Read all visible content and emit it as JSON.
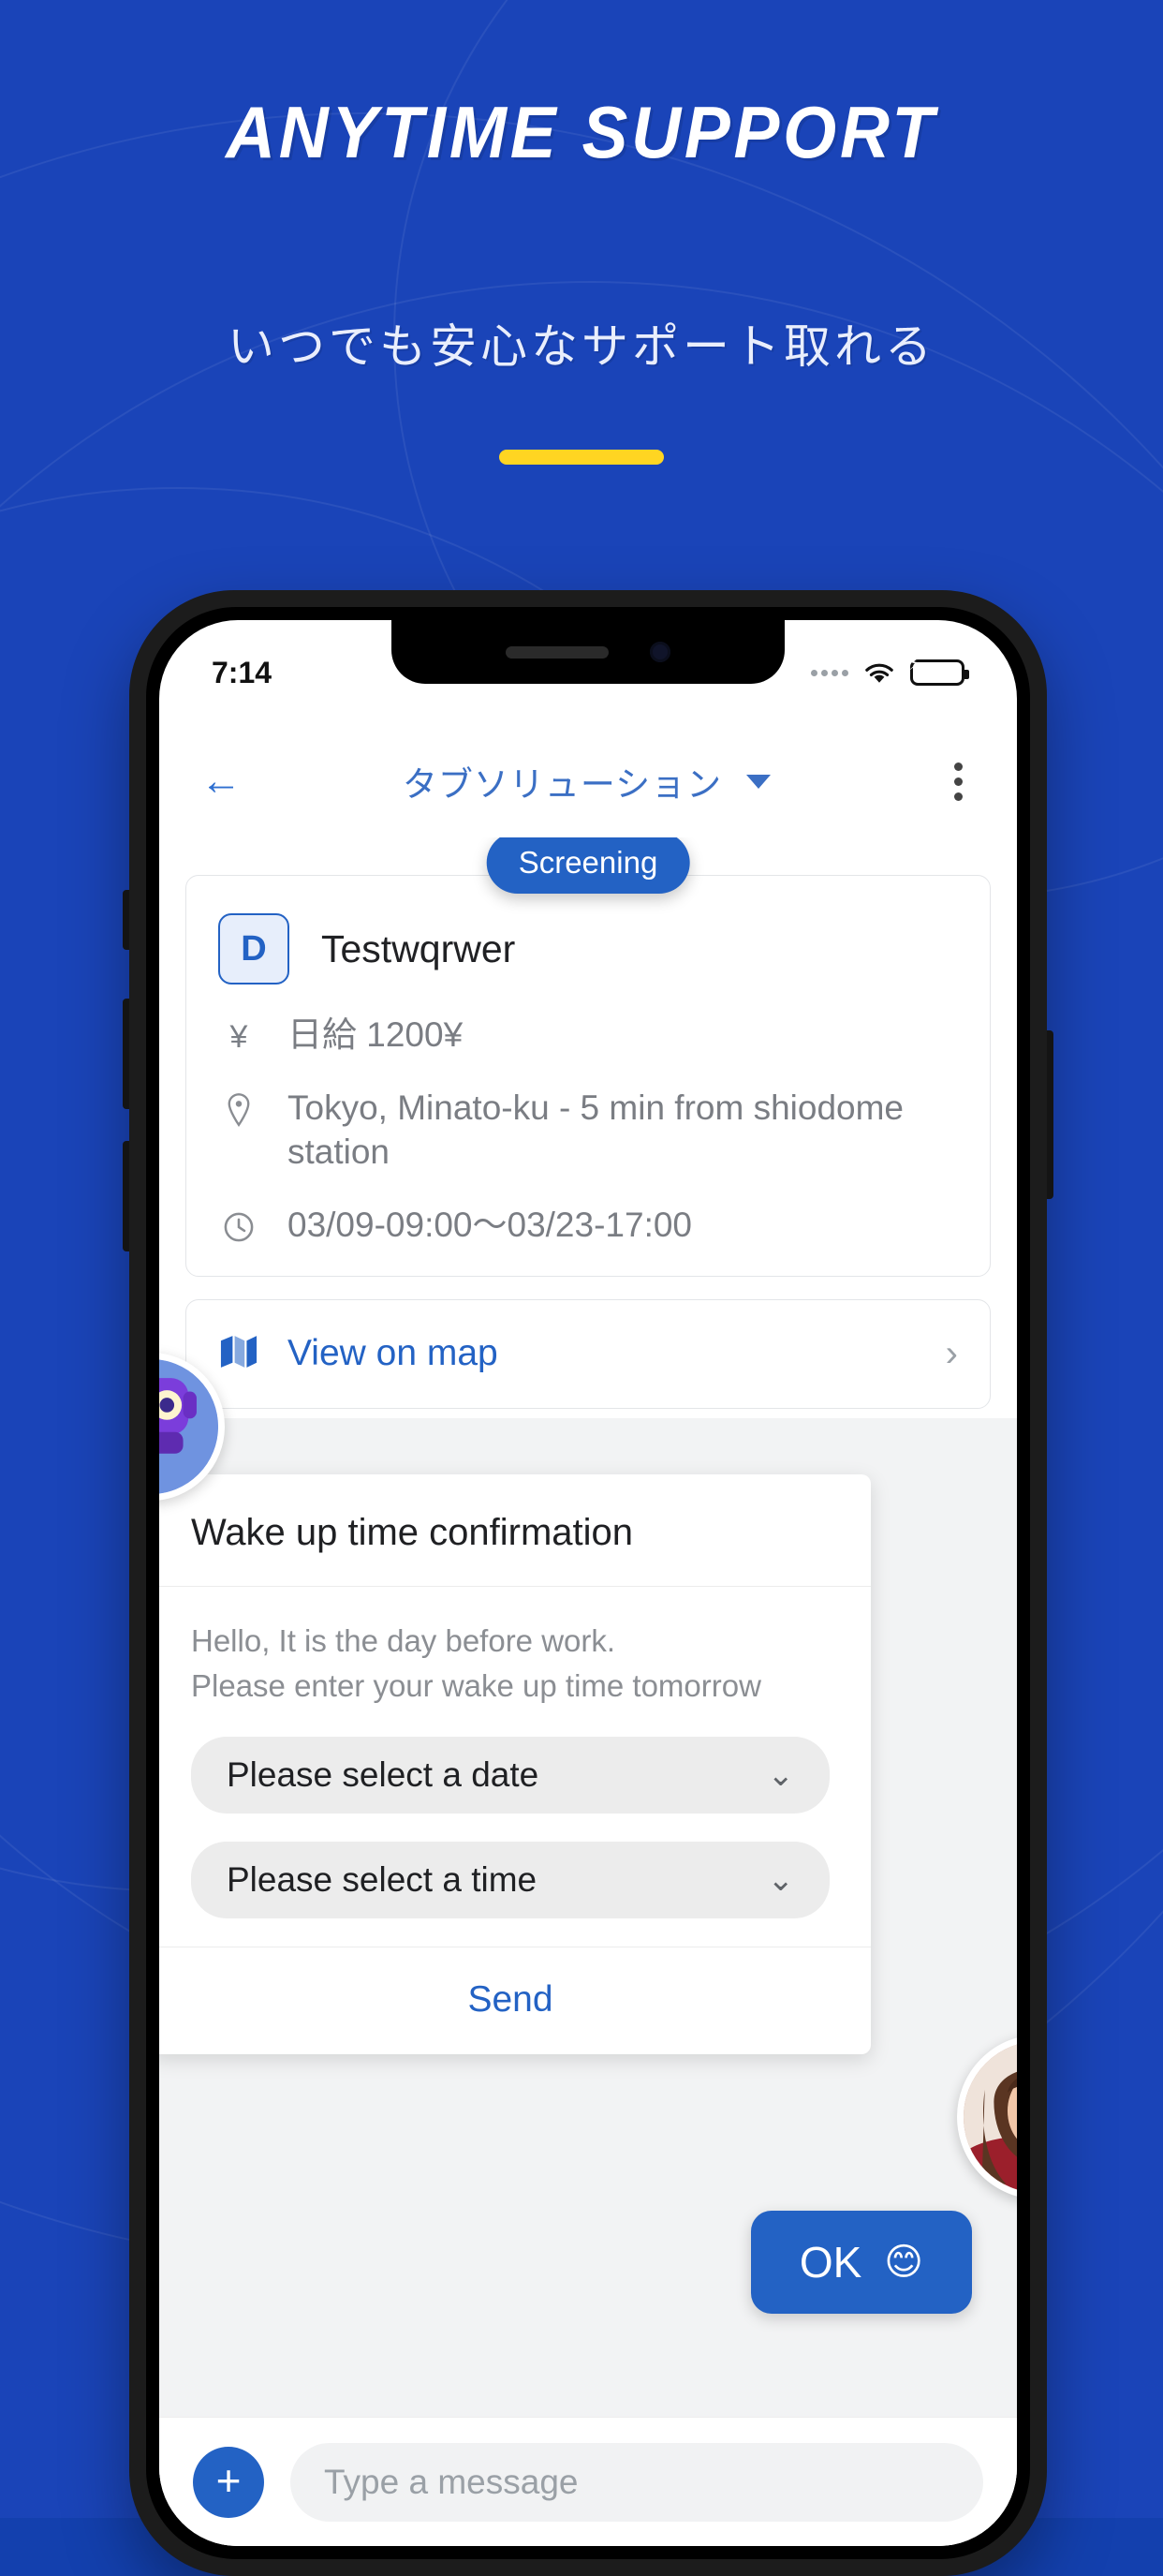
{
  "promo": {
    "headline": "ANYTIME SUPPORT",
    "subheadline": "いつでも安心なサポート取れる",
    "accent_color": "#ffd522",
    "background_color": "#1a44b8"
  },
  "phone": {
    "status_bar": {
      "time": "7:14",
      "signal_icon": "signal-dots-icon",
      "wifi_icon": "wifi-icon",
      "battery_icon": "battery-charging-icon",
      "battery_color": "#31c24d"
    },
    "app_bar": {
      "back_icon": "arrow-left-icon",
      "title": "タブソリューション",
      "dropdown_icon": "chevron-down-icon",
      "overflow_icon": "more-vertical-icon",
      "title_color": "#3b6fc4"
    },
    "job": {
      "status_chip": "Screening",
      "badge_letter": "D",
      "name": "Testwqrwer",
      "rows": [
        {
          "icon": "yen-icon",
          "text": "日給 1200¥"
        },
        {
          "icon": "location-pin-icon",
          "text": "Tokyo, Minato-ku - 5 min from shiodome station"
        },
        {
          "icon": "clock-icon",
          "text": "03/09-09:00〜03/23-17:00"
        }
      ],
      "map_link": {
        "icon": "map-icon",
        "label": "View on map",
        "chevron": "chevron-right-icon"
      }
    },
    "chat": {
      "bot_avatar_icon": "robot-avatar-icon",
      "dialog": {
        "title": "Wake up time confirmation",
        "message": "Hello, It is the day before work.\nPlease enter your wake up time tomorrow",
        "date_select": {
          "value": "Please select a date",
          "chevron": "chevron-down-icon"
        },
        "time_select": {
          "value": "Please select a time",
          "chevron": "chevron-down-icon"
        },
        "send_label": "Send"
      },
      "user_avatar_icon": "user-photo-avatar",
      "outgoing_message": {
        "text": "OK",
        "emoji": "😊",
        "bubble_color": "#2362c4"
      },
      "composer": {
        "add_icon": "plus-icon",
        "input_placeholder": "Type a message"
      }
    }
  }
}
